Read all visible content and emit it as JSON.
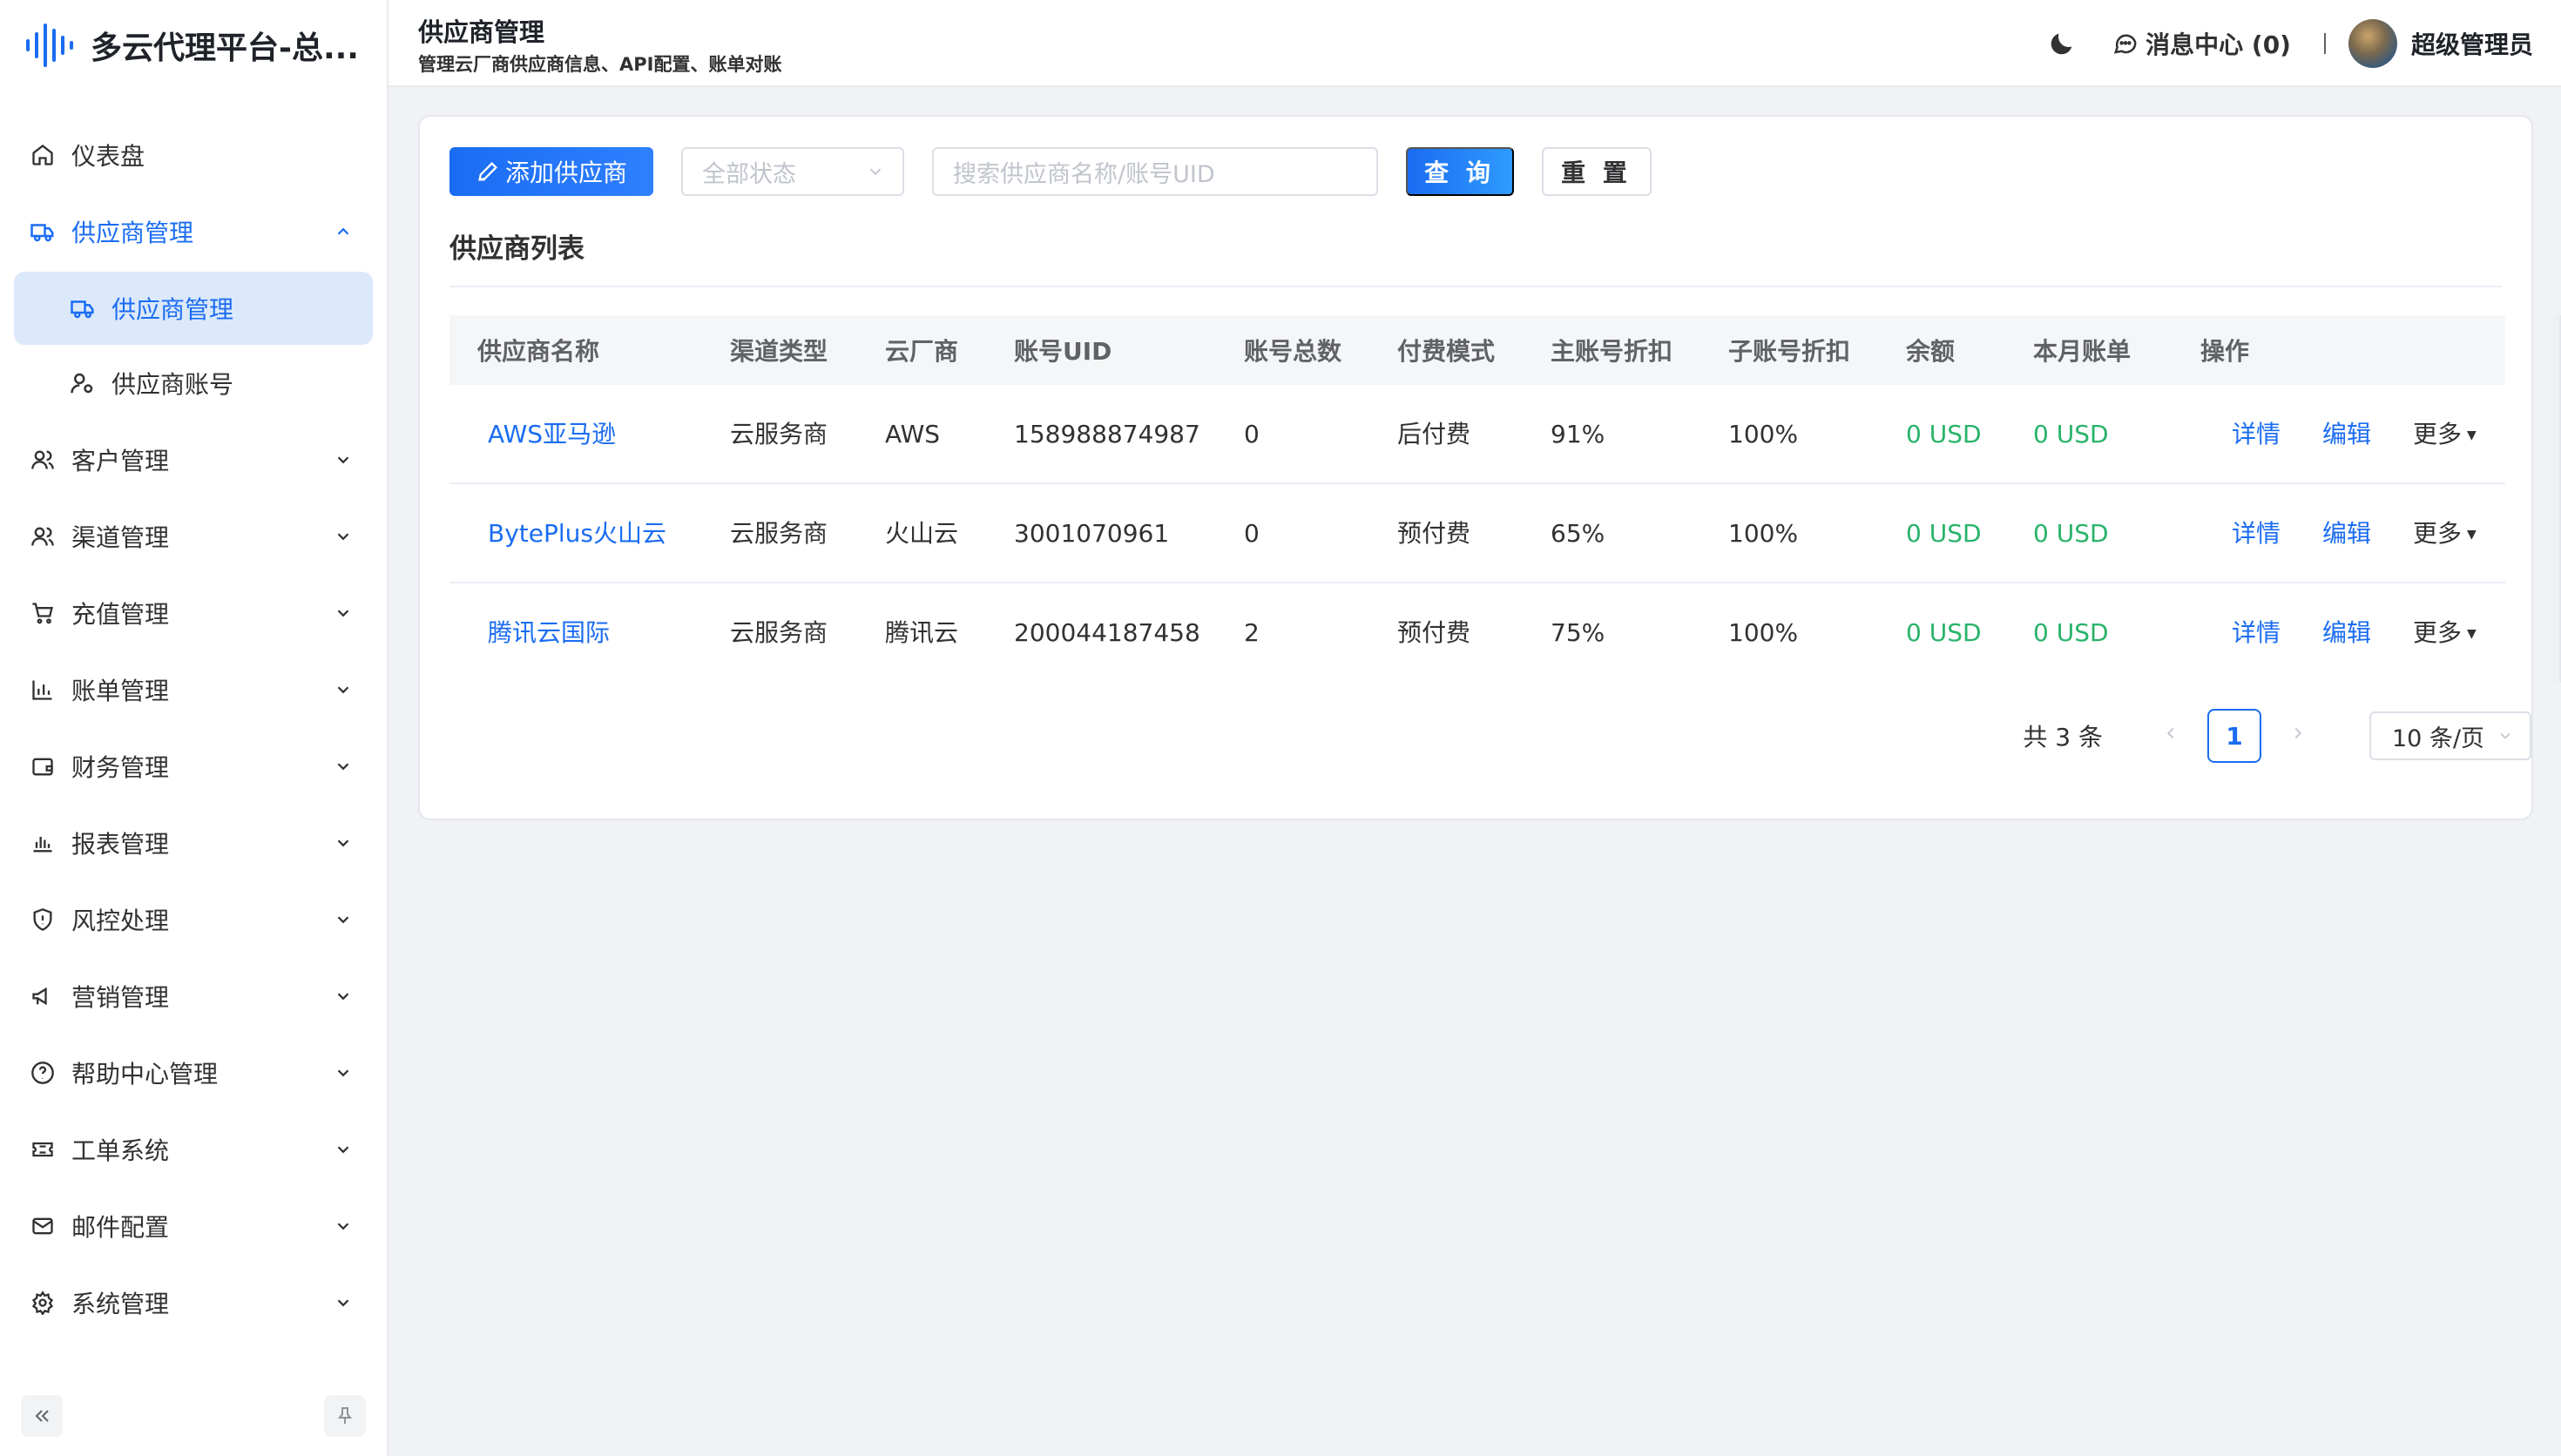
{
  "app": {
    "title": "多云代理平台-总..."
  },
  "sidebar": {
    "items": [
      {
        "label": "仪表盘",
        "icon": "home-icon",
        "expandable": false
      },
      {
        "label": "供应商管理",
        "icon": "truck-icon",
        "expandable": true,
        "expanded": true,
        "children": [
          {
            "label": "供应商管理",
            "icon": "truck-icon",
            "selected": true
          },
          {
            "label": "供应商账号",
            "icon": "user-gear-icon",
            "selected": false
          }
        ]
      },
      {
        "label": "客户管理",
        "icon": "users-icon",
        "expandable": true
      },
      {
        "label": "渠道管理",
        "icon": "users-icon",
        "expandable": true
      },
      {
        "label": "充值管理",
        "icon": "cart-icon",
        "expandable": true
      },
      {
        "label": "账单管理",
        "icon": "bar-chart-icon",
        "expandable": true
      },
      {
        "label": "财务管理",
        "icon": "wallet-icon",
        "expandable": true
      },
      {
        "label": "报表管理",
        "icon": "report-chart-icon",
        "expandable": true
      },
      {
        "label": "风控处理",
        "icon": "shield-icon",
        "expandable": true
      },
      {
        "label": "营销管理",
        "icon": "megaphone-icon",
        "expandable": true
      },
      {
        "label": "帮助中心管理",
        "icon": "help-circle-icon",
        "expandable": true
      },
      {
        "label": "工单系统",
        "icon": "ticket-icon",
        "expandable": true
      },
      {
        "label": "邮件配置",
        "icon": "mail-icon",
        "expandable": true
      },
      {
        "label": "系统管理",
        "icon": "gear-icon",
        "expandable": true
      }
    ]
  },
  "header": {
    "title": "供应商管理",
    "subtitle": "管理云厂商供应商信息、API配置、账单对账",
    "message_center": "消息中心 (0)",
    "separator": "|",
    "user_name": "超级管理员"
  },
  "toolbar": {
    "add_label": "添加供应商",
    "status_placeholder": "全部状态",
    "search_placeholder": "搜索供应商名称/账号UID",
    "query_label": "查 询",
    "reset_label": "重 置"
  },
  "list": {
    "title": "供应商列表",
    "columns": [
      "供应商名称",
      "渠道类型",
      "云厂商",
      "账号UID",
      "账号总数",
      "付费模式",
      "主账号折扣",
      "子账号折扣",
      "余额",
      "本月账单",
      "操作"
    ],
    "rows": [
      {
        "name": "AWS亚马逊",
        "channel": "云服务商",
        "vendor": "AWS",
        "uid": "158988874987",
        "count": "0",
        "pay_mode": "后付费",
        "main_discount": "91%",
        "sub_discount": "100%",
        "balance": "0 USD",
        "monthly_bill": "0 USD"
      },
      {
        "name": "BytePlus火山云",
        "channel": "云服务商",
        "vendor": "火山云",
        "uid": "3001070961",
        "count": "0",
        "pay_mode": "预付费",
        "main_discount": "65%",
        "sub_discount": "100%",
        "balance": "0 USD",
        "monthly_bill": "0 USD"
      },
      {
        "name": "腾讯云国际",
        "channel": "云服务商",
        "vendor": "腾讯云",
        "uid": "200044187458",
        "count": "2",
        "pay_mode": "预付费",
        "main_discount": "75%",
        "sub_discount": "100%",
        "balance": "0 USD",
        "monthly_bill": "0 USD"
      }
    ],
    "actions": {
      "detail": "详情",
      "edit": "编辑",
      "more": "更多"
    }
  },
  "pagination": {
    "total": "共 3 条",
    "current_page": "1",
    "page_size": "10 条/页"
  },
  "colors": {
    "accent": "#1a6cf2",
    "success": "#29b36a",
    "selected_bg": "#dce9fb"
  }
}
